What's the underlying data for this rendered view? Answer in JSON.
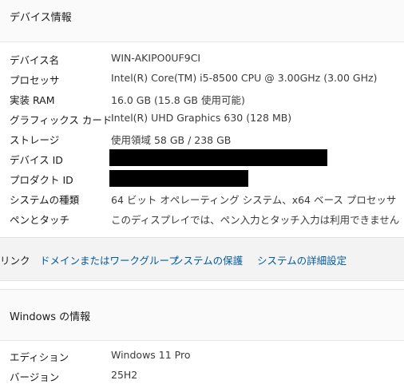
{
  "device_info": {
    "title": "デバイス情報",
    "rows": [
      {
        "label": "デバイス名",
        "value": "WIN-AKIPO0UF9CI"
      },
      {
        "label": "プロセッサ",
        "value": "Intel(R) Core(TM) i5-8500 CPU @ 3.00GHz (3.00 GHz)"
      },
      {
        "label": "実装 RAM",
        "value": "16.0 GB (15.8 GB 使用可能)"
      },
      {
        "label": "グラフィックス カード",
        "value": "Intel(R) UHD Graphics 630 (128 MB)"
      },
      {
        "label": "ストレージ",
        "value": "使用領域 58 GB / 238 GB"
      },
      {
        "label": "デバイス ID",
        "value": ""
      },
      {
        "label": "プロダクト ID",
        "value": ""
      },
      {
        "label": "システムの種類",
        "value": "64 ビット オペレーティング システム、x64 ベース プロセッサ"
      },
      {
        "label": "ペンとタッチ",
        "value": "このディスプレイでは、ペン入力とタッチ入力は利用できません"
      }
    ]
  },
  "related_links": {
    "label": "リンク",
    "links": [
      {
        "label": "ドメインまたはワークグループ"
      },
      {
        "label": "システムの保護"
      },
      {
        "label": "システムの詳細設定"
      }
    ]
  },
  "windows_info": {
    "title": "Windows の情報",
    "rows": [
      {
        "label": "エディション",
        "value": "Windows 11 Pro"
      },
      {
        "label": "バージョン",
        "value": "25H2"
      }
    ]
  }
}
